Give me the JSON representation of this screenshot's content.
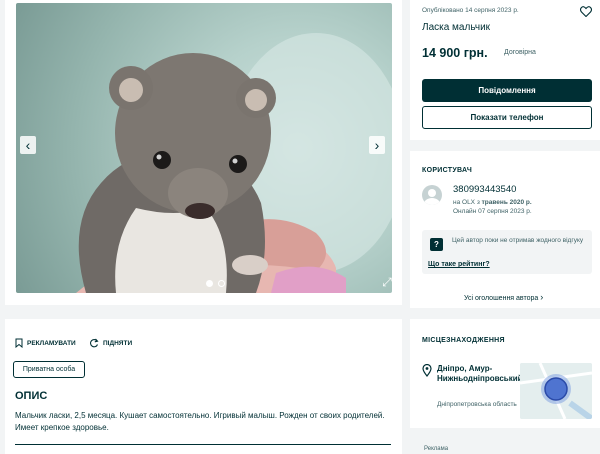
{
  "gallery": {
    "prev_arrow": "‹",
    "next_arrow": "›",
    "expand_icon": "⤢",
    "photo_count": 2,
    "active_photo": 1
  },
  "ad": {
    "published": "Опубліковано 14 серпня 2023 р.",
    "title": "Ласка мальчик",
    "price": "14 900 грн.",
    "negotiable": "Договірна",
    "message_button": "Повідомлення",
    "phone_button": "Показати телефон"
  },
  "user": {
    "section_label": "КОРИСТУВАЧ",
    "phone": "380993443540",
    "since_prefix": "на OLX з ",
    "since": "травень 2020 р.",
    "online": "Онлайн 07 серпня 2023 р.",
    "rating_text": "Цей автор поки не отримав жодного відгуку",
    "rating_link": "Що таке рейтинг?",
    "all_ads": "Усі оголошення автора"
  },
  "description": {
    "promote": "РЕКЛАМУВАТИ",
    "lift": "ПІДНЯТИ",
    "tag": "Приватна особа",
    "title": "ОПИС",
    "text": "Мальчик ласки, 2,5 месяца. Кушает самостоятельно. Игривый малыш. Рожден от своих родителей. Имеет крепкое здоровье."
  },
  "location": {
    "section_label": "МІСЦЕЗНАХОДЖЕННЯ",
    "city": "Дніпро, Амур-Нижньодніпровський",
    "region": "Дніпропетровська область"
  },
  "footer": {
    "ad_label": "Реклама"
  },
  "colors": {
    "brand_dark": "#002f34",
    "secondary_text": "#406367",
    "background": "#f2f4f5"
  }
}
